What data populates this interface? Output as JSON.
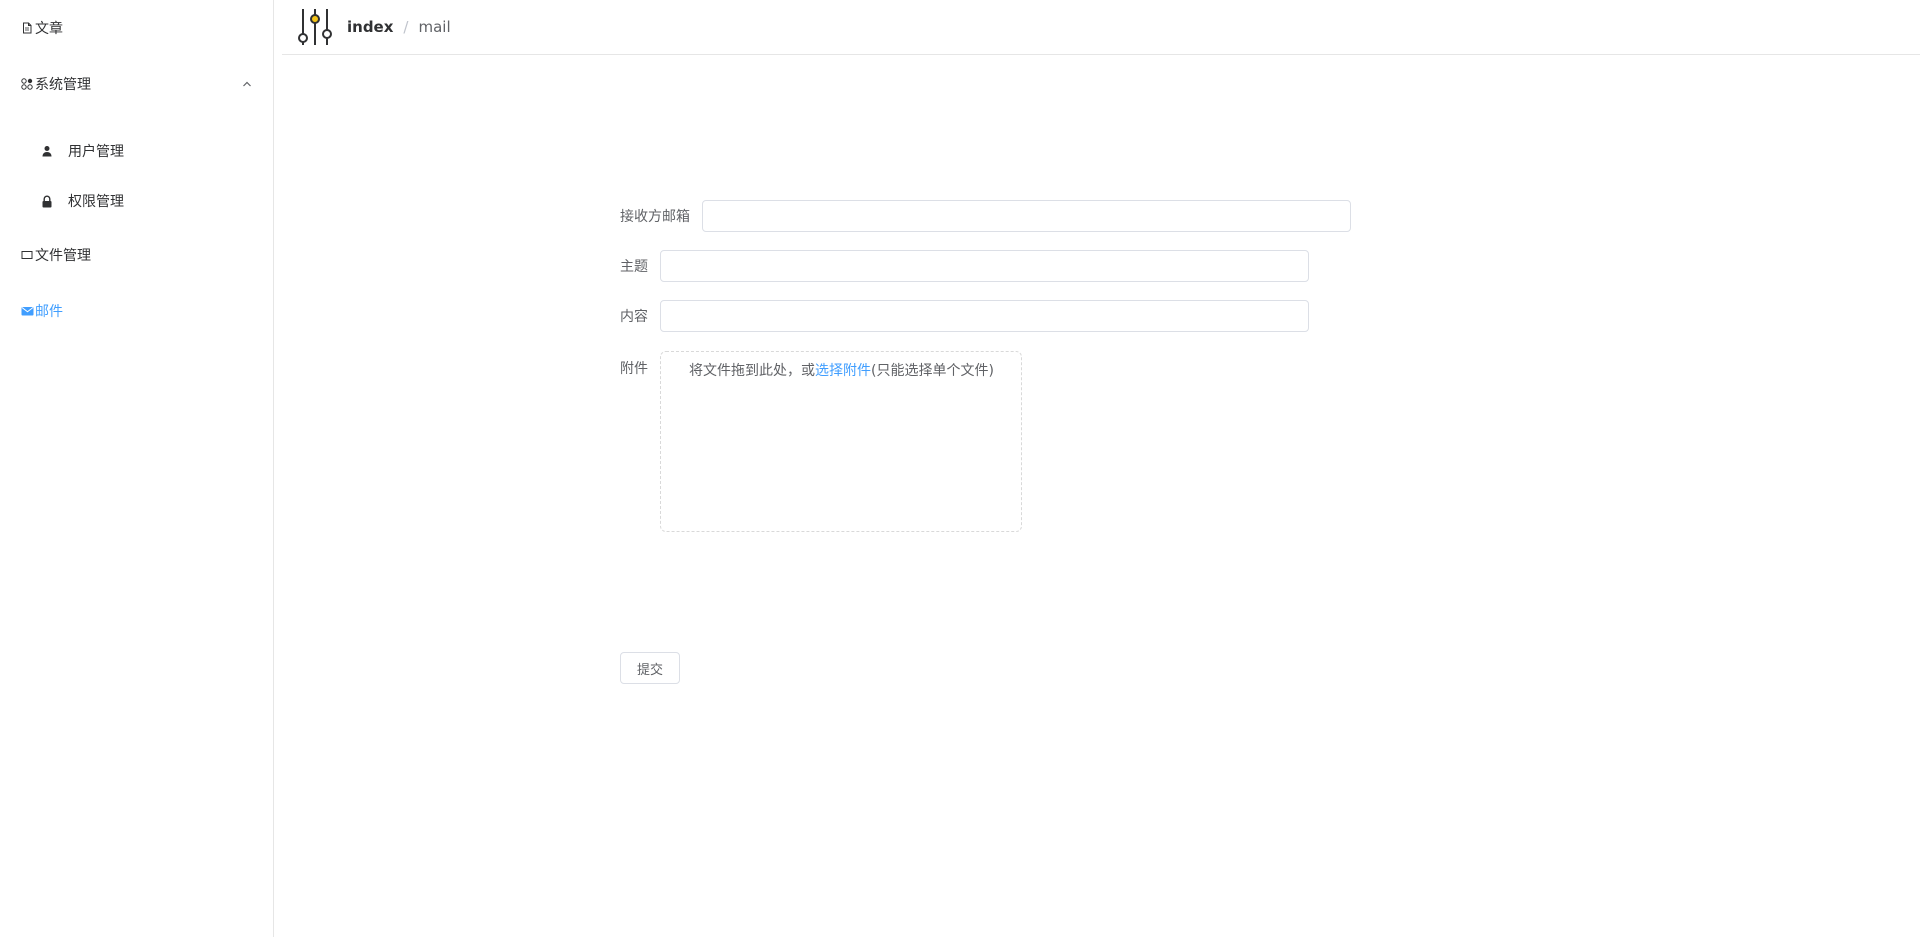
{
  "sidebar": {
    "items": [
      {
        "label": "文章",
        "icon": "document-icon"
      },
      {
        "label": "系统管理",
        "icon": "grid-icon",
        "expanded": true,
        "children": [
          {
            "label": "用户管理",
            "icon": "user-icon"
          },
          {
            "label": "权限管理",
            "icon": "lock-icon"
          }
        ]
      },
      {
        "label": "文件管理",
        "icon": "folder-icon"
      },
      {
        "label": "邮件",
        "icon": "mail-icon",
        "active": true
      }
    ]
  },
  "header": {
    "breadcrumb": {
      "index": "index",
      "separator": "/",
      "current": "mail"
    }
  },
  "form": {
    "recipient_label": "接收方邮箱",
    "recipient_value": "",
    "subject_label": "主题",
    "subject_value": "",
    "content_label": "内容",
    "content_value": "",
    "attachment_label": "附件",
    "upload_prefix": "将文件拖到此处，或",
    "upload_link": "选择附件",
    "upload_suffix": "(只能选择单个文件)",
    "submit_label": "提交"
  },
  "colors": {
    "accent": "#409eff",
    "border": "#dcdfe6",
    "text": "#303133",
    "label": "#606266",
    "logo_accent": "#f5c518"
  }
}
